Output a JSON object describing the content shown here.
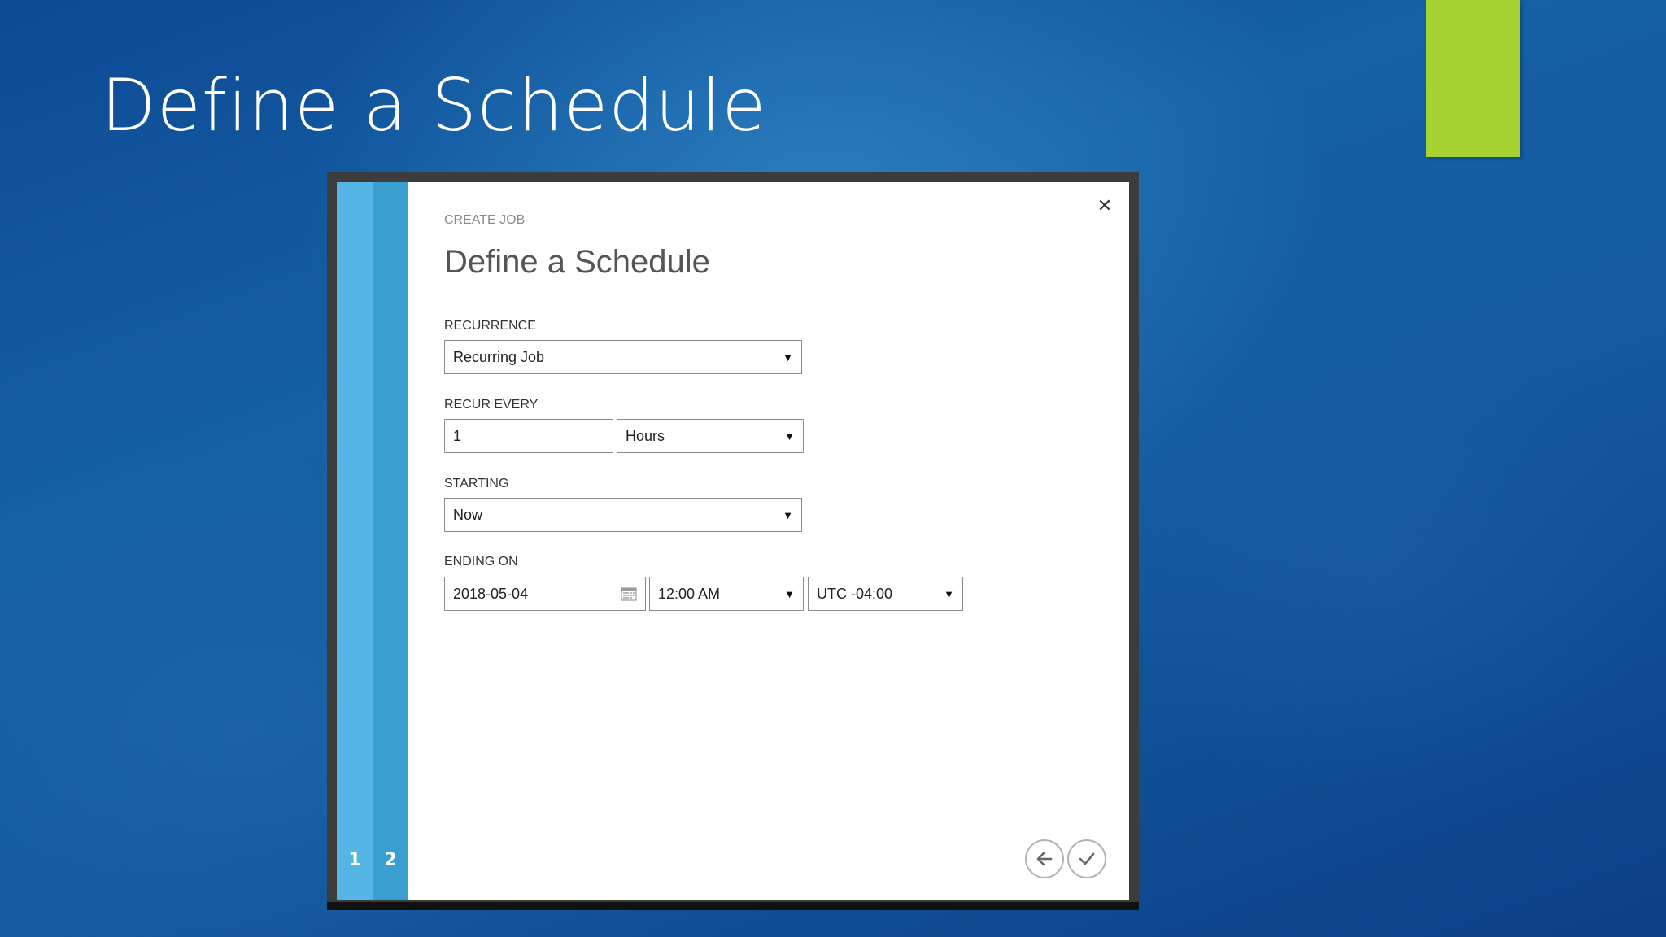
{
  "slide": {
    "title": "Define a Schedule",
    "accent_color": "#a6d331"
  },
  "wizard": {
    "steps": [
      "1",
      "2"
    ],
    "current_step": 2,
    "eyebrow": "CREATE JOB",
    "title": "Define a Schedule",
    "recurrence": {
      "label": "RECURRENCE",
      "value": "Recurring Job"
    },
    "recur_every": {
      "label": "RECUR EVERY",
      "count": "1",
      "unit": "Hours"
    },
    "starting": {
      "label": "STARTING",
      "value": "Now"
    },
    "ending_on": {
      "label": "ENDING ON",
      "date": "2018-05-04",
      "time": "12:00 AM",
      "timezone": "UTC -04:00"
    },
    "close_icon": "close-icon",
    "back_icon": "arrow-left-icon",
    "confirm_icon": "checkmark-icon"
  }
}
